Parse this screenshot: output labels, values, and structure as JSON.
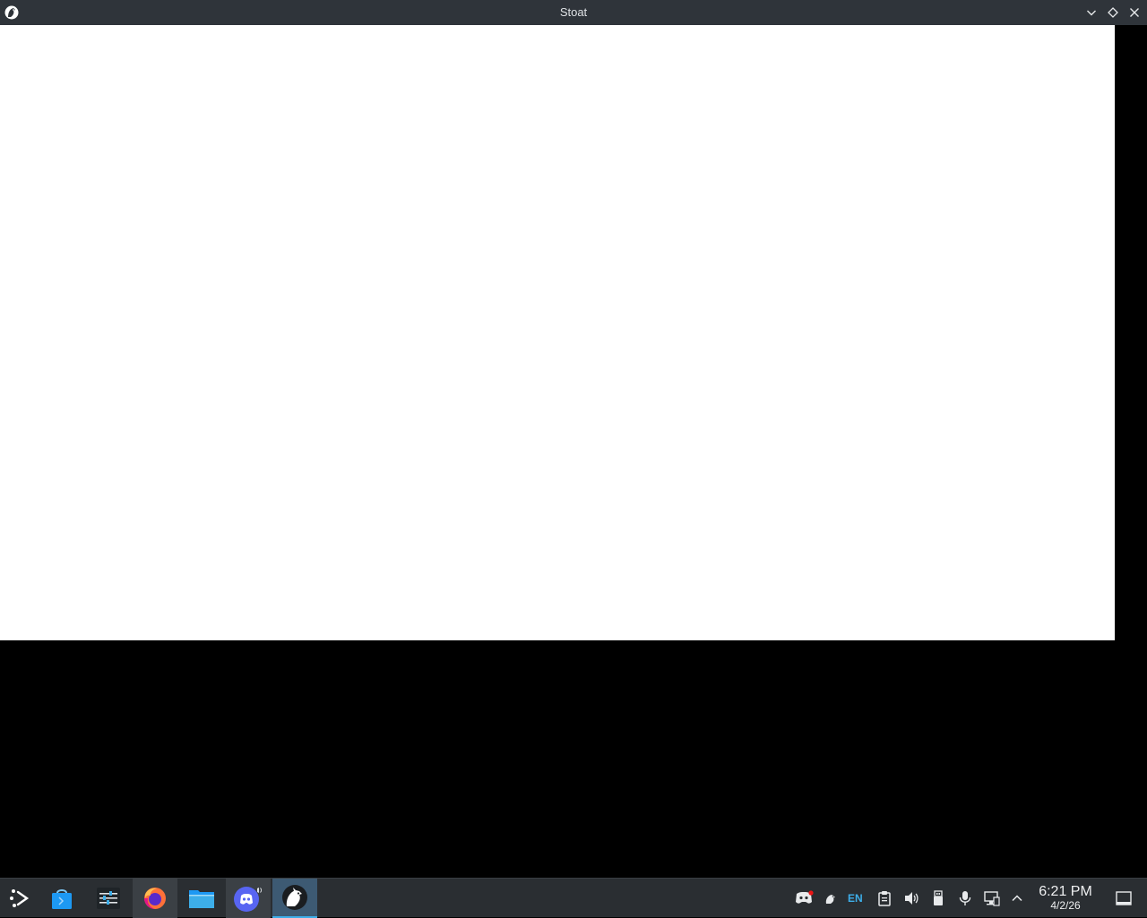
{
  "window": {
    "title": "Stoat",
    "app_icon": "stoat-app-icon",
    "controls": [
      "chevron-down-icon",
      "diamond-maximize-icon",
      "close-icon"
    ]
  },
  "taskbar": {
    "launcher_icon": "app-launcher-icon",
    "pinned": [
      {
        "name": "discover-store-icon"
      },
      {
        "name": "system-settings-icon"
      },
      {
        "name": "firefox-icon"
      },
      {
        "name": "file-manager-icon"
      },
      {
        "name": "discord-icon"
      },
      {
        "name": "stoat-icon"
      }
    ],
    "tray": {
      "language": "EN",
      "icons": [
        "discord-tray-icon",
        "stoat-tray-icon",
        "clipboard-icon",
        "volume-icon",
        "usb-device-icon",
        "microphone-icon",
        "network-icon",
        "chevron-up-icon"
      ]
    },
    "clock": {
      "time": "6:21 PM",
      "date": "4/2/26"
    },
    "show_desktop_icon": "show-desktop-icon"
  },
  "colors": {
    "titlebar": "#2f343a",
    "taskbar": "#2a2e32",
    "accent": "#3daee9",
    "desktop": "#000000",
    "window_bg": "#ffffff"
  }
}
